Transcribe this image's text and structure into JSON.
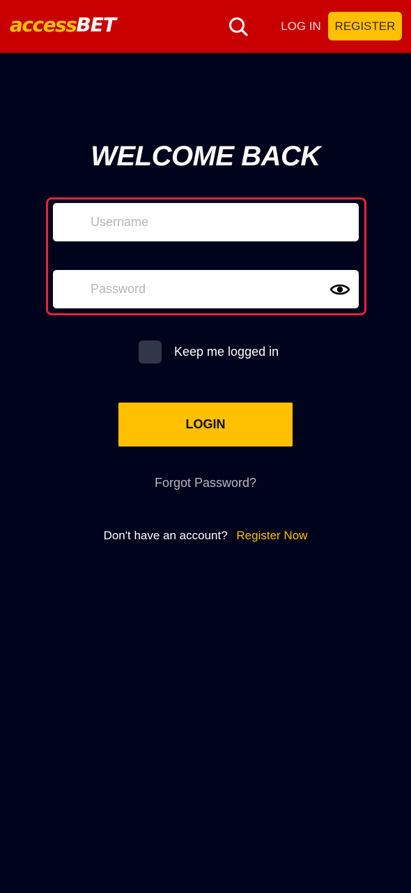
{
  "header": {
    "logo_part1": "access",
    "logo_part2": "BET",
    "login_label": "LOG IN",
    "register_label": "REGISTER",
    "search_icon": "search-icon"
  },
  "main": {
    "title": "WELCOME BACK",
    "username": {
      "value": "",
      "placeholder": "Username"
    },
    "password": {
      "value": "",
      "placeholder": "Password",
      "toggle_icon": "eye-icon"
    },
    "keep_logged_in": {
      "label": "Keep me logged in",
      "checked": false
    },
    "login_button": "LOGIN",
    "forgot_password": "Forgot Password?",
    "no_account": "Don't have an account?",
    "register_now": "Register Now"
  },
  "colors": {
    "header_bg": "#c80000",
    "page_bg": "#00031c",
    "accent": "#ffc000",
    "focus_border": "#e5233b"
  }
}
